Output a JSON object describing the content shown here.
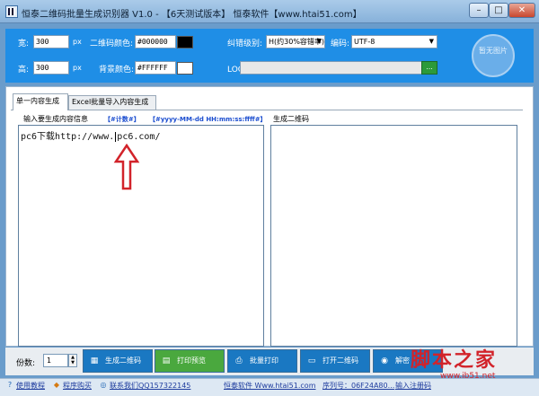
{
  "window": {
    "title": "恒泰二维码批量生成识别器 V1.0 - 【6天测试版本】 恒泰软件【www.htai51.com】",
    "controls": {
      "minimize": "–",
      "maximize": "□",
      "close": "✕"
    }
  },
  "settings": {
    "width_label": "宽:",
    "width_value": "300",
    "width_unit": "px",
    "height_label": "高:",
    "height_value": "300",
    "height_unit": "px",
    "qr_color_label": "二维码颜色:",
    "qr_color_value": "#000000",
    "bg_color_label": "背景颜色:",
    "bg_color_value": "#FFFFFF",
    "ecc_label": "纠错级别:",
    "ecc_value": "H(约30%容错率)",
    "encoding_label": "编码:",
    "encoding_value": "UTF-8",
    "logo_label": "LOGO图标:",
    "logo_value": "",
    "logo_browse": "...",
    "preview_placeholder": "暂无图片",
    "swatch_qr": "#000000",
    "swatch_bg": "#FFFFFF"
  },
  "tabs": [
    {
      "label": "单一内容生成",
      "active": true
    },
    {
      "label": "Excel批量导入内容生成",
      "active": false
    }
  ],
  "content": {
    "input_group_title": "输入要生成内容信息",
    "counter_link": "【#计数#】",
    "datetime_link": "【#yyyy-MM-dd HH:mm:ss:ffff#】",
    "output_group_title": "生成二维码",
    "text_before": "pc6下载http://www.",
    "text_after": "pc6.com/"
  },
  "toolbar": {
    "copies_label": "份数:",
    "copies_value": "1",
    "buttons": [
      {
        "label": "生成二维码",
        "icon": "qr-icon"
      },
      {
        "label": "打印预览",
        "icon": "print-preview-icon"
      },
      {
        "label": "批量打印",
        "icon": "printer-icon"
      },
      {
        "label": "打开二维码",
        "icon": "folder-icon"
      },
      {
        "label": "解密",
        "icon": "decode-icon"
      }
    ]
  },
  "watermark": {
    "text": "脚本之家",
    "url": "www.jb51.net"
  },
  "statusbar": {
    "items": [
      "使用教程",
      "程序购买",
      "联系我们QQ157322145",
      "恒泰软件 Www.htai51.com",
      "序列号：06F24A80...",
      "输入注册码"
    ]
  },
  "colors": {
    "accent": "#1f8ee6",
    "action_blue": "#1a78c2",
    "action_green": "#4aa83e",
    "annotation_red": "#d2232a"
  }
}
